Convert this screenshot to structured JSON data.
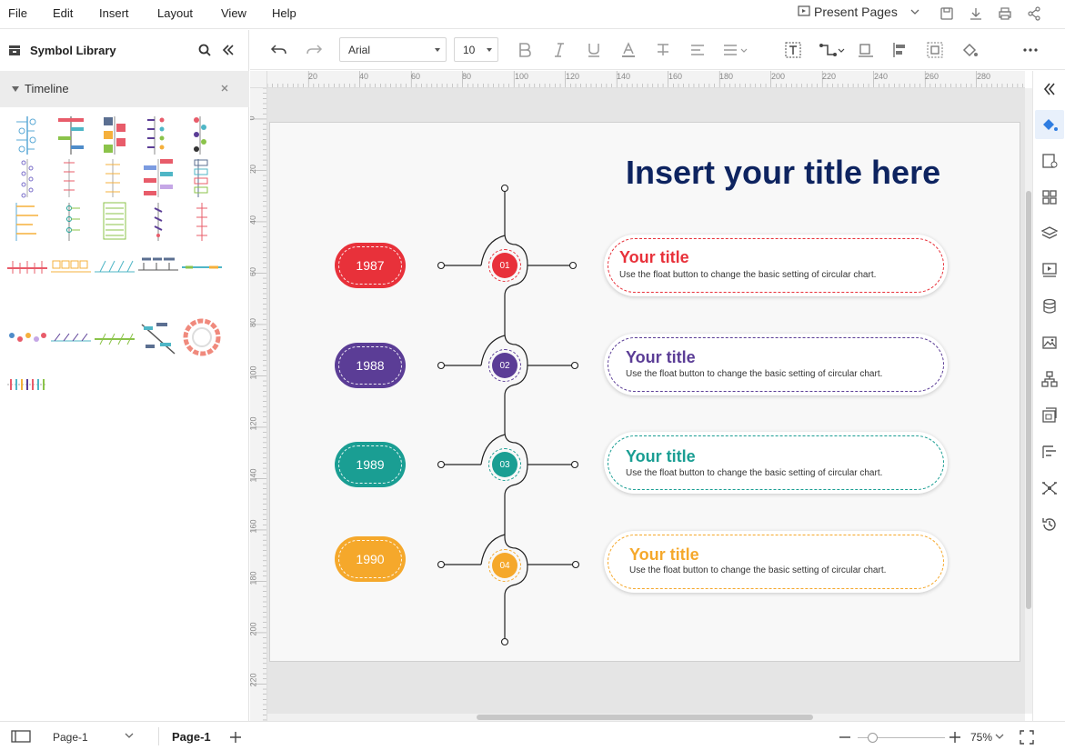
{
  "menu": [
    "File",
    "Edit",
    "Insert",
    "Layout",
    "View",
    "Help"
  ],
  "present_label": "Present Pages",
  "sidebar": {
    "title": "Symbol Library",
    "category": "Timeline"
  },
  "toolbar": {
    "font": "Arial",
    "size": "10"
  },
  "ruler": {
    "top": [
      "20",
      "40",
      "60",
      "80",
      "100",
      "120",
      "140",
      "160",
      "180",
      "200",
      "220",
      "240",
      "260",
      "280"
    ],
    "left": [
      "0",
      "20",
      "40",
      "60",
      "80",
      "100",
      "120",
      "140",
      "160",
      "180",
      "200",
      "220"
    ]
  },
  "slide": {
    "title": "Insert your title here",
    "rows": [
      {
        "year": "1987",
        "num": "01",
        "card_title": "Your title",
        "desc": "Use the float button to change the basic setting of circular chart.",
        "color": "#e8313a"
      },
      {
        "year": "1988",
        "num": "02",
        "card_title": "Your title",
        "desc": "Use the float button to change the basic setting of circular chart.",
        "color": "#5b3d96"
      },
      {
        "year": "1989",
        "num": "03",
        "card_title": "Your title",
        "desc": "Use the float button to change the basic setting of circular chart.",
        "color": "#1a9e93"
      },
      {
        "year": "1990",
        "num": "04",
        "card_title": "Your title",
        "desc": "Use the float button to change the basic setting of circular chart.",
        "color": "#f5a82b"
      }
    ],
    "title_color": "#0e2460"
  },
  "status": {
    "page_select": "Page-1",
    "page_tab": "Page-1",
    "zoom": "75%"
  }
}
